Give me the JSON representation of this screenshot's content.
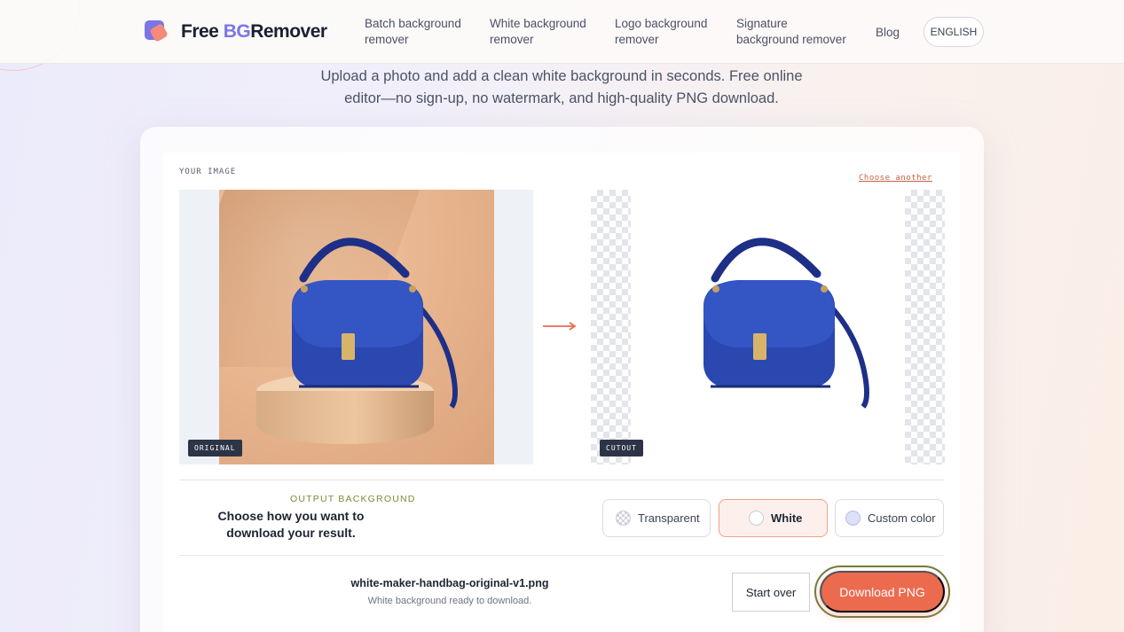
{
  "brand": {
    "name_prefix": "Free ",
    "name_accent": "BG",
    "name_suffix": "Remover"
  },
  "nav": {
    "items": [
      {
        "line1": "Batch background",
        "line2": "remover"
      },
      {
        "line1": "White background",
        "line2": "remover"
      },
      {
        "line1": "Logo background",
        "line2": "remover"
      },
      {
        "line1": "Signature",
        "line2": "background remover"
      },
      {
        "line1": "Blog",
        "line2": ""
      }
    ],
    "language": "ENGLISH"
  },
  "hero": {
    "subtitle_line1": "Upload a photo and add a clean white background in seconds. Free online",
    "subtitle_line2": "editor—no sign-up, no watermark, and high-quality PNG download."
  },
  "editor": {
    "your_image_label": "YOUR IMAGE",
    "choose_another": "Choose another",
    "original_badge": "ORIGINAL",
    "cutout_badge": "CUTOUT"
  },
  "output": {
    "label": "OUTPUT BACKGROUND",
    "description": "Choose how you want to download your result.",
    "options": [
      {
        "label": "Transparent",
        "icon": "checkerboard-swatch-icon"
      },
      {
        "label": "White",
        "icon": "white-swatch-icon",
        "selected": true
      },
      {
        "label": "Custom color",
        "icon": "color-swatch-icon"
      }
    ]
  },
  "download": {
    "filename": "white-maker-handbag-original-v1.png",
    "status": "White background ready to download.",
    "start_over": "Start over",
    "download_label": "Download PNG"
  },
  "colors": {
    "accent_coral": "#ec6b4f",
    "accent_purple": "#7b76e6",
    "olive": "#7c8a3a"
  }
}
